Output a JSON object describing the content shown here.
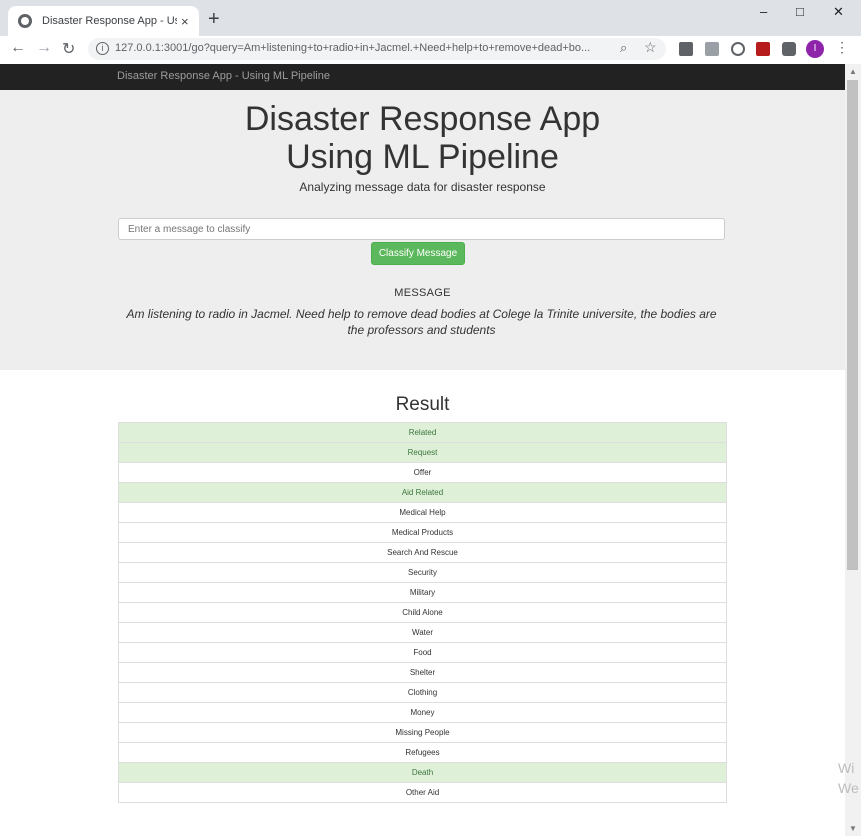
{
  "browser": {
    "tab_title": "Disaster Response App - Using ML",
    "tab_close": "×",
    "new_tab": "+",
    "url": "127.0.0.1:3001/go?query=Am+listening+to+radio+in+Jacmel.+Need+help+to+remove+dead+bo...",
    "info": "i",
    "avatar_letter": "I"
  },
  "navbar": {
    "brand": "Disaster Response App - Using ML Pipeline"
  },
  "hero": {
    "title_line1": "Disaster Response App",
    "title_line2": "Using ML Pipeline",
    "subtitle": "Analyzing message data for disaster response",
    "input_placeholder": "Enter a message to classify",
    "classify_button": "Classify Message",
    "message_label": "MESSAGE",
    "message": "Am listening to radio in Jacmel. Need help to remove dead bodies at Colege la Trinite universite, the bodies are the professors and students"
  },
  "result": {
    "title": "Result",
    "categories": [
      {
        "label": "Related",
        "positive": true
      },
      {
        "label": "Request",
        "positive": true
      },
      {
        "label": "Offer",
        "positive": false
      },
      {
        "label": "Aid Related",
        "positive": true
      },
      {
        "label": "Medical Help",
        "positive": false
      },
      {
        "label": "Medical Products",
        "positive": false
      },
      {
        "label": "Search And Rescue",
        "positive": false
      },
      {
        "label": "Security",
        "positive": false
      },
      {
        "label": "Military",
        "positive": false
      },
      {
        "label": "Child Alone",
        "positive": false
      },
      {
        "label": "Water",
        "positive": false
      },
      {
        "label": "Food",
        "positive": false
      },
      {
        "label": "Shelter",
        "positive": false
      },
      {
        "label": "Clothing",
        "positive": false
      },
      {
        "label": "Money",
        "positive": false
      },
      {
        "label": "Missing People",
        "positive": false
      },
      {
        "label": "Refugees",
        "positive": false
      },
      {
        "label": "Death",
        "positive": true
      },
      {
        "label": "Other Aid",
        "positive": false
      }
    ]
  },
  "watermark": {
    "line1": "Wi",
    "line2": "We"
  },
  "colors": {
    "positive_bg": "#dff0d8",
    "positive_text": "#3c763d",
    "button_green": "#5cb85c",
    "navbar_bg": "#222222"
  },
  "icons": [
    "globe-icon",
    "back-icon",
    "forward-icon",
    "reload-icon",
    "zoom-icon",
    "star-icon",
    "extension-icon",
    "menu-icon"
  ]
}
